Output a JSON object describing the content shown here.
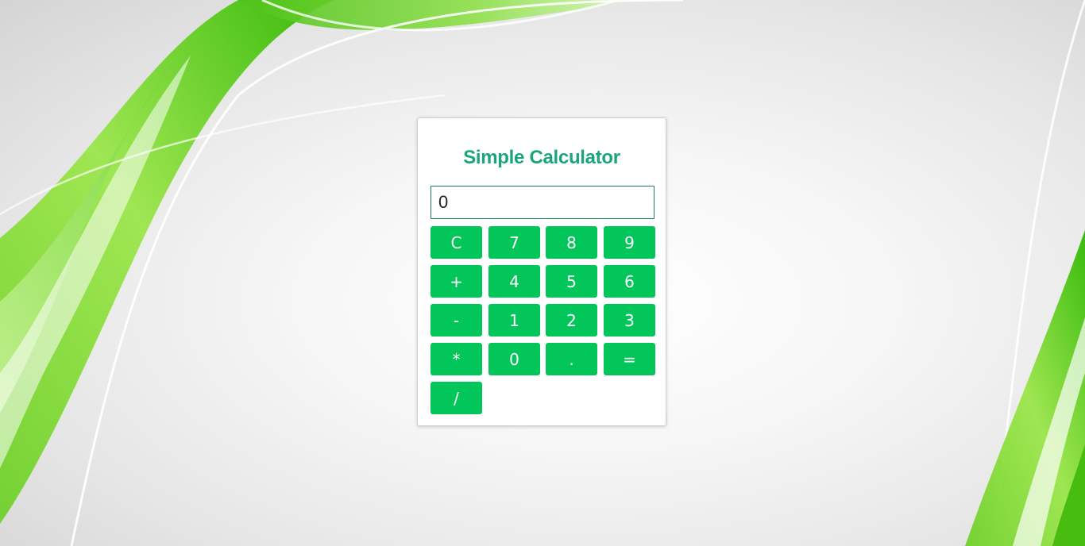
{
  "calculator": {
    "title": "Simple Calculator",
    "display_value": "0",
    "keys": {
      "clear": "C",
      "seven": "7",
      "eight": "8",
      "nine": "9",
      "plus": "+",
      "four": "4",
      "five": "5",
      "six": "6",
      "minus": "-",
      "one": "1",
      "two": "2",
      "three": "3",
      "multiply": "*",
      "zero": "0",
      "decimal": ".",
      "equals": "=",
      "divide": "/"
    }
  },
  "colors": {
    "accent": "#1aa57a",
    "button": "#03c65a",
    "background_wave": "#52c41a"
  }
}
